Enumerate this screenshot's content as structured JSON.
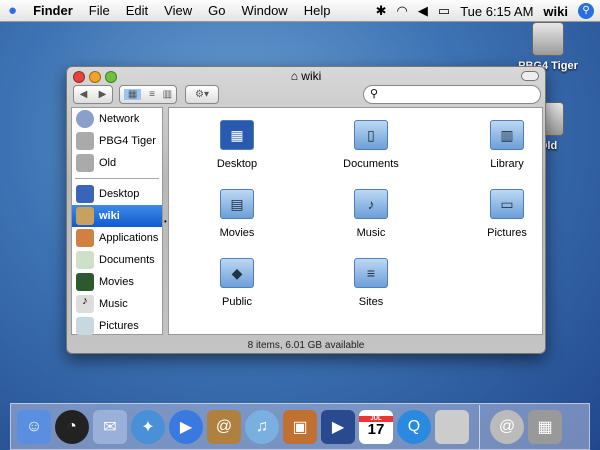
{
  "menubar": {
    "apple": "",
    "items": [
      "Finder",
      "File",
      "Edit",
      "View",
      "Go",
      "Window",
      "Help"
    ],
    "clock": "Tue 6:15 AM",
    "user": "wiki",
    "status_icons": [
      "bluetooth-icon",
      "wifi-icon",
      "volume-icon",
      "battery-icon",
      "spotlight-icon"
    ]
  },
  "desktop": {
    "icons": [
      {
        "label": "PBG4 Tiger"
      },
      {
        "label": "Old"
      }
    ]
  },
  "window": {
    "title": "wiki",
    "search_placeholder": "",
    "status": "8 items, 6.01 GB available",
    "sidebar": {
      "devices": [
        {
          "label": "Network",
          "color": "#8aa0c8"
        },
        {
          "label": "PBG4 Tiger",
          "color": "#aaa"
        },
        {
          "label": "Old",
          "color": "#aaa"
        }
      ],
      "places": [
        {
          "label": "Desktop",
          "color": "#3a64b8"
        },
        {
          "label": "wiki",
          "color": "#c8a060",
          "selected": true
        },
        {
          "label": "Applications",
          "color": "#d08040"
        },
        {
          "label": "Documents",
          "color": "#cfe0c8"
        },
        {
          "label": "Movies",
          "color": "#2c5a2c"
        },
        {
          "label": "Music",
          "color": "#ddd"
        },
        {
          "label": "Pictures",
          "color": "#c8d8e0"
        }
      ]
    },
    "items": [
      {
        "label": "Desktop",
        "glyph": "▦"
      },
      {
        "label": "Documents",
        "glyph": "▯"
      },
      {
        "label": "Library",
        "glyph": "▥"
      },
      {
        "label": "Movies",
        "glyph": "▤"
      },
      {
        "label": "Music",
        "glyph": "♪"
      },
      {
        "label": "Pictures",
        "glyph": "▭"
      },
      {
        "label": "Public",
        "glyph": "◆"
      },
      {
        "label": "Sites",
        "glyph": "≡"
      }
    ]
  },
  "dock": {
    "apps": [
      {
        "name": "Finder",
        "color": "#5a8ee0",
        "glyph": "☺"
      },
      {
        "name": "Dashboard",
        "color": "#222",
        "glyph": "◔"
      },
      {
        "name": "Mail",
        "color": "#9ab0d8",
        "glyph": "✉"
      },
      {
        "name": "Safari",
        "color": "#4a90d8",
        "glyph": "✦"
      },
      {
        "name": "iChat",
        "color": "#3a7ae0",
        "glyph": "▶"
      },
      {
        "name": "Address Book",
        "color": "#b08040",
        "glyph": "@"
      },
      {
        "name": "iTunes",
        "color": "#7ab0e0",
        "glyph": "♫"
      },
      {
        "name": "iPhoto",
        "color": "#c07030",
        "glyph": "▣"
      },
      {
        "name": "iMovie",
        "color": "#2a4a90",
        "glyph": "▶"
      },
      {
        "name": "iCal",
        "color": "#fff",
        "glyph": "17",
        "month": "JUL"
      },
      {
        "name": "QuickTime",
        "color": "#2a8ae0",
        "glyph": "Q"
      },
      {
        "name": "System Preferences",
        "color": "#ccc",
        "glyph": ""
      }
    ],
    "others": [
      {
        "name": "Mail Downloads",
        "color": "#bbb",
        "glyph": "@"
      },
      {
        "name": "Trash",
        "color": "#999",
        "glyph": "▦"
      }
    ]
  }
}
